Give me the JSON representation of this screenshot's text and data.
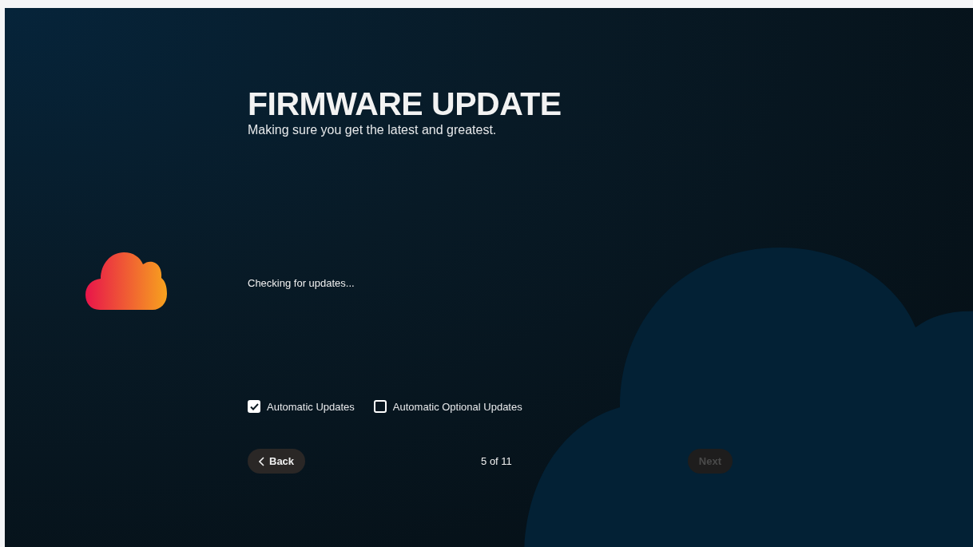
{
  "header": {
    "title": "FIRMWARE UPDATE",
    "subtitle": "Making sure you get the latest and greatest."
  },
  "status": "Checking for updates...",
  "options": [
    {
      "label": "Automatic Updates",
      "checked": true
    },
    {
      "label": "Automatic Optional Updates",
      "checked": false
    }
  ],
  "nav": {
    "back": {
      "label": "Back",
      "disabled": false
    },
    "step": "5 of 11",
    "next": {
      "label": "Next",
      "disabled": true
    }
  }
}
